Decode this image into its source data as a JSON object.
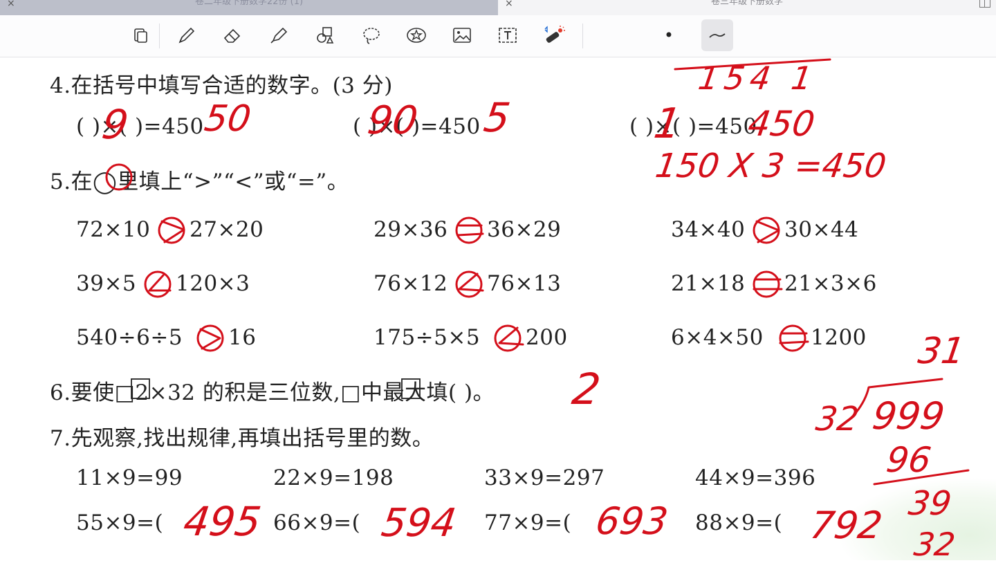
{
  "tabs": [
    {
      "label": "卷二年级下册数学22份 (1)",
      "close": "×",
      "active": true
    },
    {
      "label": "卷三年级下册数学",
      "close": "×",
      "active": false
    }
  ],
  "toolbar": {
    "tools": [
      "page-icon",
      "pen-icon",
      "eraser-icon",
      "highlighter-icon",
      "shapes-icon",
      "lasso-icon",
      "sticker-icon",
      "image-icon",
      "text-icon",
      "laser-pointer-icon"
    ],
    "bluetooth": "bluetooth-icon",
    "dot": "•",
    "selected_tool": "stroke-style-icon"
  },
  "q4": {
    "title": "4.在括号中填写合适的数字。(3 分)",
    "row": [
      {
        "text": "(      )×(      )=450",
        "a": "9",
        "b": "50"
      },
      {
        "text": "(      )×(      )=450",
        "a": "90",
        "b": "5"
      },
      {
        "text": "(      )×(      )=450",
        "a": "1",
        "b": "450"
      }
    ],
    "note_top": "154  1",
    "note_eq": "150 X  3 =450"
  },
  "q5": {
    "title": "5.在◯里填上“>”“<”或“=”。",
    "rows": [
      [
        {
          "left": "72×10",
          "right": "27×20",
          "ans": ">"
        },
        {
          "left": "29×36",
          "right": "36×29",
          "ans": "="
        },
        {
          "left": "34×40",
          "right": "30×44",
          "ans": ">"
        }
      ],
      [
        {
          "left": "39×5",
          "right": "120×3",
          "ans": "<"
        },
        {
          "left": "76×12",
          "right": "76×13",
          "ans": "<"
        },
        {
          "left": "21×18",
          "right": "21×3×6",
          "ans": "="
        }
      ],
      [
        {
          "left": "540÷6÷5",
          "right": "16",
          "ans": ">"
        },
        {
          "left": "175÷5×5",
          "right": "200",
          "ans": "<"
        },
        {
          "left": "6×4×50",
          "right": "1200",
          "ans": "="
        }
      ]
    ]
  },
  "q6": {
    "title": "6.要使□2×32 的积是三位数,□中最大填(          )。",
    "answer": "2"
  },
  "q7": {
    "title": "7.先观察,找出规律,再填出括号里的数。",
    "given": [
      "11×9=99",
      "22×9=198",
      "33×9=297",
      "44×9=396"
    ],
    "asked": [
      {
        "text": "55×9=(",
        "answer": "495"
      },
      {
        "text": "66×9=(",
        "answer": "594"
      },
      {
        "text": "77×9=(",
        "answer": "693"
      },
      {
        "text": "88×9=(",
        "answer": "792"
      }
    ]
  },
  "side_calc": {
    "quotient": "31",
    "divisor": "32",
    "dividend": "999",
    "step1": "96",
    "step2": "39",
    "step3": "32"
  }
}
